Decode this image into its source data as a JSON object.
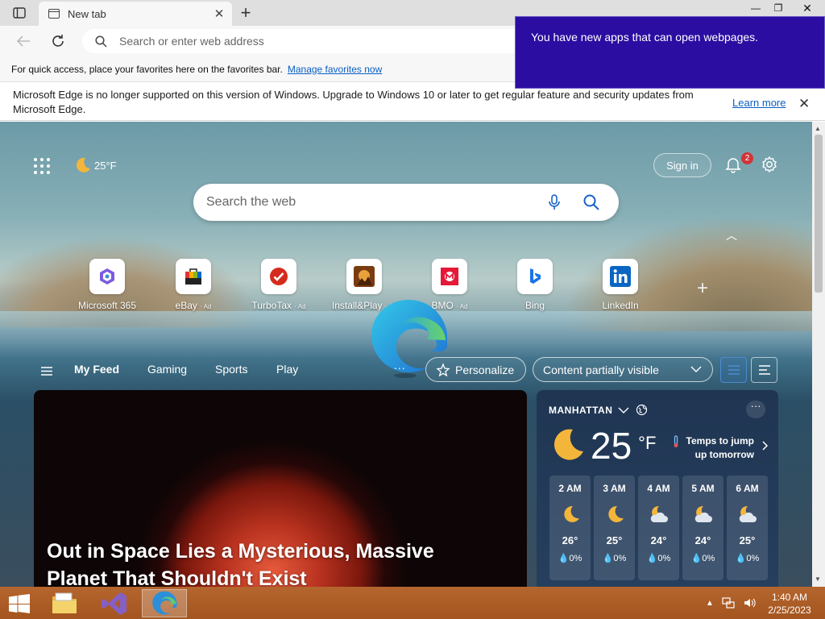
{
  "browser": {
    "tab_title": "New tab",
    "address_placeholder": "Search or enter web address",
    "favorites_prompt": "For quick access, place your favorites here on the favorites bar.",
    "manage_favorites": "Manage favorites now"
  },
  "banner": {
    "message": "Microsoft Edge is no longer supported on this version of Windows. Upgrade to Windows 10 or later to get regular feature and security updates from Microsoft Edge.",
    "learn_more": "Learn more"
  },
  "popup": {
    "message": "You have new apps that can open webpages."
  },
  "ntp": {
    "weather_mini": "25°F",
    "sign_in": "Sign in",
    "notifications_count": "2",
    "search_placeholder": "Search the web",
    "quick_links": [
      {
        "name": "Microsoft 365",
        "ad": ""
      },
      {
        "name": "eBay",
        "ad": "· Ad"
      },
      {
        "name": "TurboTax",
        "ad": "· Ad"
      },
      {
        "name": "Install&Play",
        "ad": "· Ad"
      },
      {
        "name": "BMO",
        "ad": "· Ad"
      },
      {
        "name": "Bing",
        "ad": ""
      },
      {
        "name": "LinkedIn",
        "ad": ""
      }
    ],
    "feed_tabs": [
      "My Feed",
      "Gaming",
      "Sports",
      "Play"
    ],
    "more": "...",
    "personalize": "Personalize",
    "content_visibility": "Content partially visible"
  },
  "hero": {
    "title": "Out in Space Lies a Mysterious, Massive Planet That Shouldn't Exist"
  },
  "weather": {
    "location": "MANHATTAN",
    "temp": "25",
    "unit": "°F",
    "note": "Temps to jump up tomorrow",
    "hourly": [
      {
        "time": "2 AM",
        "icon": "moon-icon",
        "temp": "26°",
        "precip": "0%"
      },
      {
        "time": "3 AM",
        "icon": "moon-icon",
        "temp": "25°",
        "precip": "0%"
      },
      {
        "time": "4 AM",
        "icon": "moon-cloud-icon",
        "temp": "24°",
        "precip": "0%"
      },
      {
        "time": "5 AM",
        "icon": "moon-cloud-icon",
        "temp": "24°",
        "precip": "0%"
      },
      {
        "time": "6 AM",
        "icon": "moon-cloud-icon",
        "temp": "25°",
        "precip": "0%"
      }
    ]
  },
  "taskbar": {
    "time": "1:40 AM",
    "date": "2/25/2023"
  },
  "colors": {
    "popup_bg": "#2b0da2",
    "link": "#0a5ec5",
    "taskbar": "#ad5c26"
  }
}
